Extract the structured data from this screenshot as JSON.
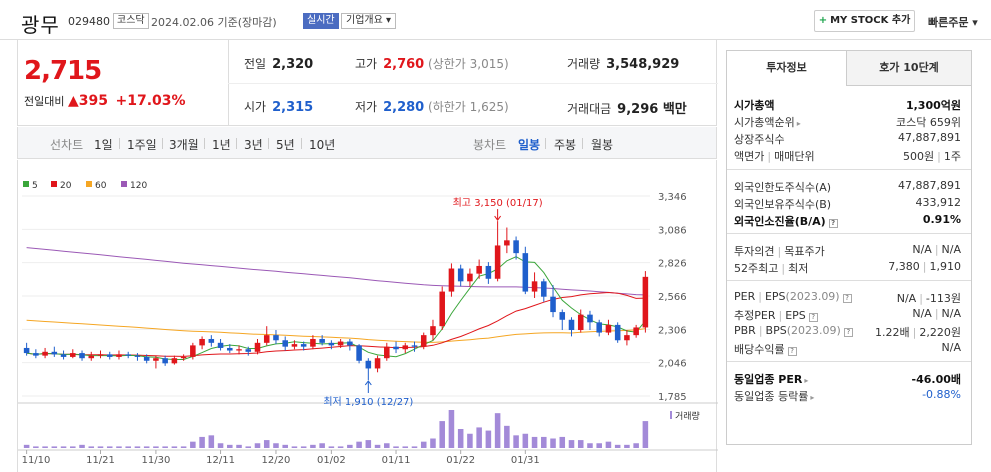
{
  "header": {
    "stock_name": "광무",
    "stock_code": "029480",
    "market": "코스닥",
    "date": "2024.02.06 기준(장마감)",
    "realtime": "실시간",
    "company_overview": "기업개요 ▾",
    "mystock_button": "MY STOCK 추가",
    "quick_order": "빠른주문 ▾"
  },
  "price": {
    "current": "2,715",
    "change_label": "전일대비",
    "change_arrow": "▲",
    "change": "395",
    "change_pct": "+17.03%"
  },
  "quote": {
    "prev_close_label": "전일",
    "prev_close": "2,320",
    "high_label": "고가",
    "high": "2,760",
    "upper_limit": "(상한가 3,015)",
    "volume_label": "거래량",
    "volume": "3,548,929",
    "open_label": "시가",
    "open": "2,315",
    "low_label": "저가",
    "low": "2,280",
    "lower_limit": "(하한가 1,625)",
    "trade_amount_label": "거래대금",
    "trade_amount": "9,296 백만"
  },
  "toolbar": {
    "line_chart_label": "선차트",
    "periods": [
      "1일",
      "1주일",
      "3개월",
      "1년",
      "3년",
      "5년",
      "10년"
    ],
    "candle_label": "봉차트",
    "candle_periods": [
      "일봉",
      "주봉",
      "월봉"
    ],
    "selected_candle": "일봉"
  },
  "chart_data": {
    "type": "candlestick",
    "legend": [
      {
        "name": "5",
        "color": "#3aa63a"
      },
      {
        "name": "20",
        "color": "#e0161b"
      },
      {
        "name": "60",
        "color": "#f5a623"
      },
      {
        "name": "120",
        "color": "#9b59b6"
      }
    ],
    "y_ticks": [
      "3,346",
      "3,086",
      "2,826",
      "2,566",
      "2,306",
      "2,046",
      "1,785"
    ],
    "ylim": [
      1785,
      3346
    ],
    "x_ticks": [
      "11/10",
      "11/21",
      "11/30",
      "12/11",
      "12/20",
      "01/02",
      "01/11",
      "01/22",
      "01/31"
    ],
    "high_annotation": "최고 3,150 (01/17)",
    "low_annotation": "최저 1,910 (12/27)",
    "volume_label": "거래량",
    "colors": {
      "up": "#e0161b",
      "down": "#1f5fcc"
    },
    "candles": [
      [
        2160,
        2120,
        2200,
        2100
      ],
      [
        2120,
        2100,
        2150,
        2080
      ],
      [
        2100,
        2130,
        2160,
        2080
      ],
      [
        2130,
        2110,
        2170,
        2090
      ],
      [
        2110,
        2090,
        2140,
        2070
      ],
      [
        2090,
        2120,
        2150,
        2080
      ],
      [
        2120,
        2080,
        2140,
        2060
      ],
      [
        2080,
        2100,
        2130,
        2060
      ],
      [
        2100,
        2110,
        2140,
        2080
      ],
      [
        2110,
        2090,
        2130,
        2070
      ],
      [
        2090,
        2110,
        2140,
        2070
      ],
      [
        2110,
        2100,
        2130,
        2080
      ],
      [
        2100,
        2090,
        2120,
        2060
      ],
      [
        2090,
        2060,
        2110,
        2040
      ],
      [
        2060,
        2080,
        2100,
        2000
      ],
      [
        2080,
        2040,
        2100,
        2020
      ],
      [
        2040,
        2080,
        2100,
        2030
      ],
      [
        2080,
        2090,
        2110,
        2060
      ],
      [
        2090,
        2180,
        2200,
        2070
      ],
      [
        2180,
        2230,
        2250,
        2150
      ],
      [
        2230,
        2200,
        2260,
        2170
      ],
      [
        2200,
        2160,
        2230,
        2140
      ],
      [
        2160,
        2140,
        2190,
        2120
      ],
      [
        2140,
        2150,
        2180,
        2110
      ],
      [
        2150,
        2130,
        2170,
        2100
      ],
      [
        2130,
        2200,
        2230,
        2110
      ],
      [
        2200,
        2260,
        2330,
        2180
      ],
      [
        2260,
        2220,
        2300,
        2190
      ],
      [
        2220,
        2170,
        2250,
        2140
      ],
      [
        2170,
        2190,
        2220,
        2150
      ],
      [
        2190,
        2170,
        2210,
        2140
      ],
      [
        2170,
        2230,
        2260,
        2150
      ],
      [
        2230,
        2200,
        2260,
        2180
      ],
      [
        2200,
        2180,
        2220,
        2150
      ],
      [
        2180,
        2210,
        2230,
        2160
      ],
      [
        2210,
        2180,
        2230,
        2140
      ],
      [
        2180,
        2060,
        2190,
        2040
      ],
      [
        2060,
        2000,
        2080,
        1910
      ],
      [
        2000,
        2080,
        2100,
        1970
      ],
      [
        2080,
        2170,
        2200,
        2060
      ],
      [
        2170,
        2150,
        2210,
        2120
      ],
      [
        2150,
        2180,
        2200,
        2120
      ],
      [
        2180,
        2170,
        2210,
        2130
      ],
      [
        2170,
        2260,
        2280,
        2150
      ],
      [
        2260,
        2330,
        2380,
        2220
      ],
      [
        2330,
        2600,
        2640,
        2300
      ],
      [
        2600,
        2780,
        2820,
        2560
      ],
      [
        2780,
        2680,
        2810,
        2640
      ],
      [
        2680,
        2740,
        2780,
        2640
      ],
      [
        2740,
        2800,
        2850,
        2700
      ],
      [
        2800,
        2700,
        2830,
        2660
      ],
      [
        2700,
        2960,
        3150,
        2680
      ],
      [
        2960,
        3000,
        3100,
        2900
      ],
      [
        3000,
        2900,
        3030,
        2850
      ],
      [
        2900,
        2600,
        2950,
        2580
      ],
      [
        2600,
        2680,
        2750,
        2550
      ],
      [
        2680,
        2560,
        2700,
        2520
      ],
      [
        2560,
        2440,
        2650,
        2400
      ],
      [
        2440,
        2380,
        2460,
        2300
      ],
      [
        2380,
        2300,
        2400,
        2250
      ],
      [
        2300,
        2420,
        2460,
        2280
      ],
      [
        2420,
        2360,
        2450,
        2300
      ],
      [
        2360,
        2280,
        2380,
        2250
      ],
      [
        2280,
        2340,
        2380,
        2260
      ],
      [
        2340,
        2220,
        2360,
        2200
      ],
      [
        2220,
        2260,
        2300,
        2180
      ],
      [
        2260,
        2320,
        2340,
        2240
      ],
      [
        2320,
        2715,
        2760,
        2280
      ]
    ],
    "volumes": [
      2,
      1,
      1,
      1,
      1,
      1,
      2,
      1,
      1,
      1,
      1,
      1,
      1,
      1,
      1,
      1,
      1,
      1,
      4,
      7,
      8,
      3,
      2,
      2,
      1,
      3,
      5,
      3,
      2,
      1,
      1,
      2,
      3,
      1,
      1,
      2,
      4,
      5,
      2,
      3,
      1,
      1,
      1,
      4,
      6,
      17,
      24,
      12,
      9,
      13,
      11,
      22,
      14,
      8,
      9,
      7,
      7,
      6,
      7,
      5,
      5,
      3,
      3,
      4,
      2,
      2,
      3,
      17
    ]
  },
  "right_panel": {
    "tabs": [
      "투자정보",
      "호가 10단계"
    ],
    "market_cap_label": "시가총액",
    "market_cap": "1,300억원",
    "market_cap_rank_label": "시가총액순위",
    "market_cap_rank": "코스닥 659위",
    "shares_label": "상장주식수",
    "shares": "47,887,891",
    "par_label": "액면가",
    "lot_label": "매매단위",
    "par_value": "500원",
    "lot": "1주",
    "foreign_limit_label": "외국인한도주식수(A)",
    "foreign_limit": "47,887,891",
    "foreign_hold_label": "외국인보유주식수(B)",
    "foreign_hold": "433,912",
    "foreign_ratio_label": "외국인소진율(B/A)",
    "foreign_ratio": "0.91%",
    "opinion_label": "투자의견",
    "target_label": "목표주가",
    "opinion": "N/A",
    "target": "N/A",
    "week52_high_label": "52주최고",
    "week52_low_label": "최저",
    "week52_high": "7,380",
    "week52_low": "1,910",
    "per_label": "PER",
    "eps_label": "EPS",
    "eps_period": "(2023.09)",
    "per": "N/A",
    "eps": "-113원",
    "est_per_label": "추정PER",
    "est_eps_label": "EPS",
    "est_per": "N/A",
    "est_eps": "N/A",
    "pbr_label": "PBR",
    "bps_label": "BPS",
    "bps_period": "(2023.09)",
    "pbr": "1.22배",
    "bps": "2,220원",
    "dividend_label": "배당수익률",
    "dividend": "N/A",
    "industry_per_label": "동일업종 PER",
    "industry_per": "-46.00배",
    "industry_chg_label": "동일업종 등락률",
    "industry_chg": "-0.88%"
  }
}
